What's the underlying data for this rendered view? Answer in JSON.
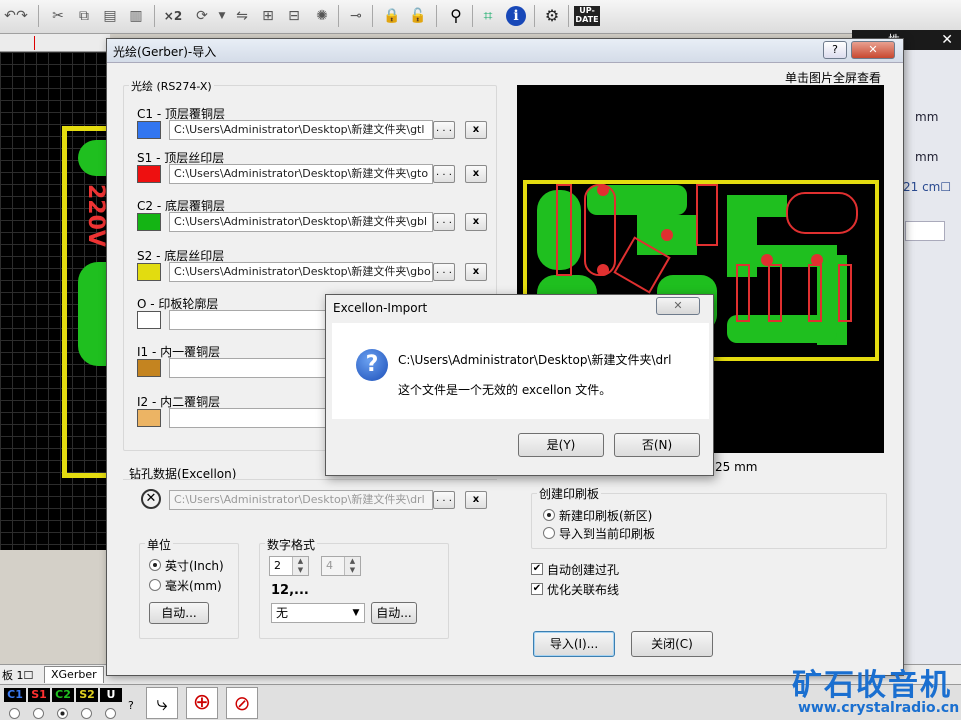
{
  "app": {
    "tab_label_1": "板 1☐",
    "tab_label_2": "XGerber",
    "props_title": "性",
    "props_unit_1": "mm",
    "props_unit_2": "mm",
    "props_unit_3": "21 cm☐",
    "toolbar_multiplier": "×2",
    "toolbar_update": "UP-\nDATE"
  },
  "layer_bar": {
    "layers": [
      {
        "code": "C1",
        "color": "#3a7af0"
      },
      {
        "code": "S1",
        "color": "#ff3030"
      },
      {
        "code": "C2",
        "color": "#20c020"
      },
      {
        "code": "S2",
        "color": "#e0d020"
      },
      {
        "code": "U",
        "color": "#ffffff"
      }
    ],
    "question": "?"
  },
  "gerber_dialog": {
    "title": "光绘(Gerber)-导入",
    "help_btn": "?",
    "close_btn": "✕",
    "section_title": "光绘 (RS274-X)",
    "layers": [
      {
        "label": "C1 - 顶层覆铜层",
        "color": "#3276f0",
        "path": "C:\\Users\\Administrator\\Desktop\\新建文件夹\\gtl"
      },
      {
        "label": "S1 - 顶层丝印层",
        "color": "#ee1010",
        "path": "C:\\Users\\Administrator\\Desktop\\新建文件夹\\gto"
      },
      {
        "label": "C2 - 底层覆铜层",
        "color": "#14b414",
        "path": "C:\\Users\\Administrator\\Desktop\\新建文件夹\\gbl"
      },
      {
        "label": "S2 - 底层丝印层",
        "color": "#e2dc10",
        "path": "C:\\Users\\Administrator\\Desktop\\新建文件夹\\gbo"
      },
      {
        "label": "O  - 印板轮廓层",
        "color": "#ffffff",
        "path": ""
      },
      {
        "label": "I1 - 内一覆铜层",
        "color": "#c48420",
        "path": ""
      },
      {
        "label": "I2 - 内二覆铜层",
        "color": "#ecb464",
        "path": ""
      }
    ],
    "browse_label": ". . .",
    "clear_label": "x",
    "preview_hint": "单击图片全屏查看",
    "preview_dim_fragment": "25 mm",
    "drill_section": "钻孔数据(Excellon)",
    "drill_path": "C:\\Users\\Administrator\\Desktop\\新建文件夹\\drl",
    "unit_group": "单位",
    "unit_inch": "英寸(Inch)",
    "unit_mm": "毫米(mm)",
    "auto_btn": "自动...",
    "format_group": "数字格式",
    "format_int": "2",
    "format_dec": "4",
    "format_preview": "12,...",
    "format_select": "无",
    "auto_btn_2": "自动...",
    "create_group": "创建印刷板",
    "create_new": "新建印刷板(新区)",
    "create_import": "导入到当前印刷板",
    "auto_via": "自动创建过孔",
    "optimize": "优化关联布线",
    "import_btn": "导入(I)...",
    "close_btn_bottom": "关闭(C)"
  },
  "excellon_dialog": {
    "title": "Excellon-Import",
    "close_btn": "✕",
    "icon": "question-icon",
    "path": "C:\\Users\\Administrator\\Desktop\\新建文件夹\\drl",
    "message": "这个文件是一个无效的 excellon 文件。",
    "yes": "是(Y)",
    "no": "否(N)"
  },
  "watermark": {
    "logo": "矿石收音机",
    "url": "www.crystalradio.cn"
  }
}
